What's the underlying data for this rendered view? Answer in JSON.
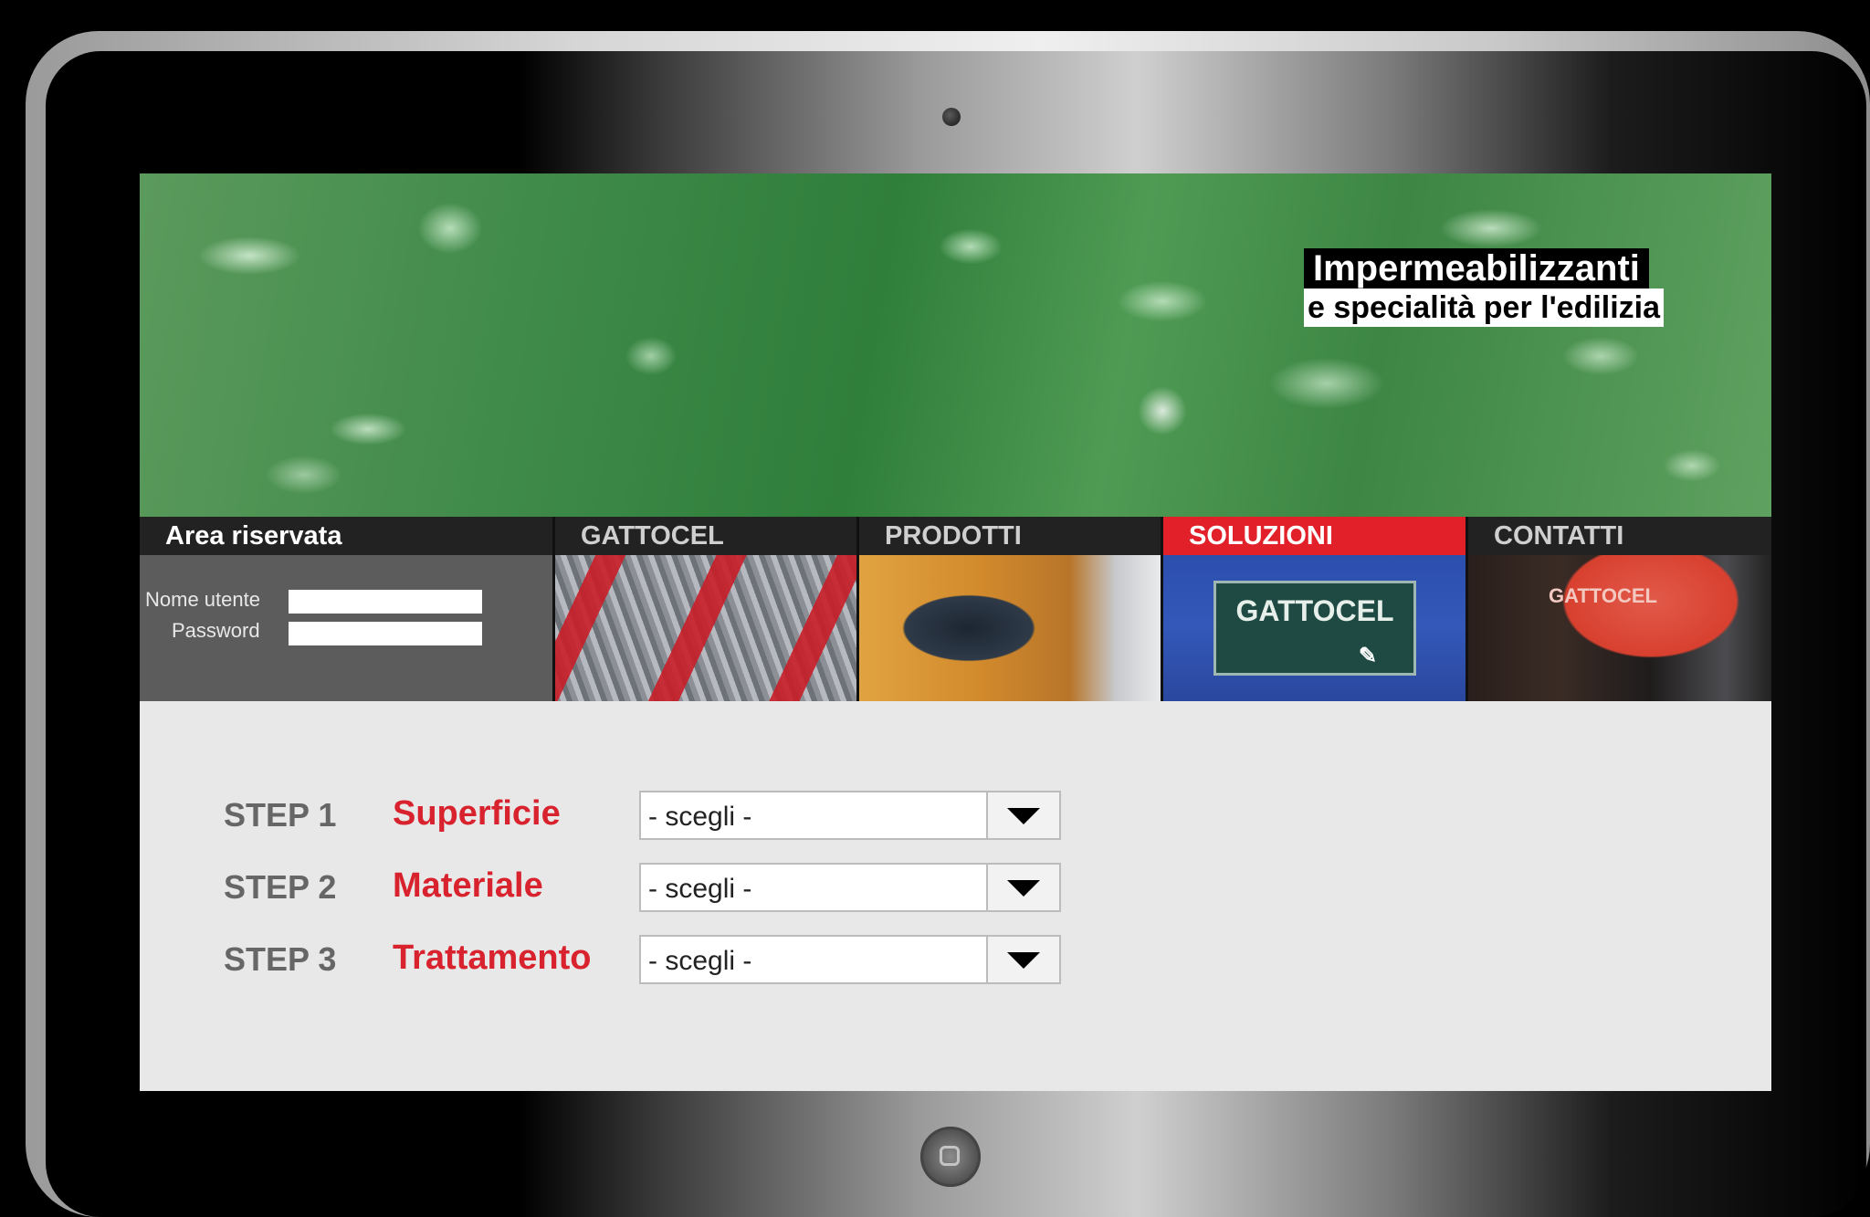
{
  "hero": {
    "title_line1": "Impermeabilizzanti",
    "title_line2": "e specialità per l'edilizia"
  },
  "nav": {
    "area_label": "Area riservata",
    "items": [
      {
        "label": "GATTOCEL",
        "active": false
      },
      {
        "label": "PRODOTTI",
        "active": false
      },
      {
        "label": "SOLUZIONI",
        "active": true
      },
      {
        "label": "CONTATTI",
        "active": false
      }
    ]
  },
  "login": {
    "username_label": "Nome utente",
    "password_label": "Password",
    "username_value": "",
    "password_value": ""
  },
  "thumbnails": {
    "soluzioni_card_text": "GATTOCEL",
    "contatti_sign_text": "GATTOCEL"
  },
  "steps": [
    {
      "step": "STEP 1",
      "title": "Superficie",
      "value": "- scegli -"
    },
    {
      "step": "STEP 2",
      "title": "Materiale",
      "value": "- scegli -"
    },
    {
      "step": "STEP 3",
      "title": "Trattamento",
      "value": "- scegli -"
    }
  ],
  "colors": {
    "accent_red": "#e2202a",
    "step_title_red": "#d8222d",
    "nav_bg": "#222222",
    "login_panel": "#5c5c5c",
    "content_bg": "#e8e8e8"
  }
}
